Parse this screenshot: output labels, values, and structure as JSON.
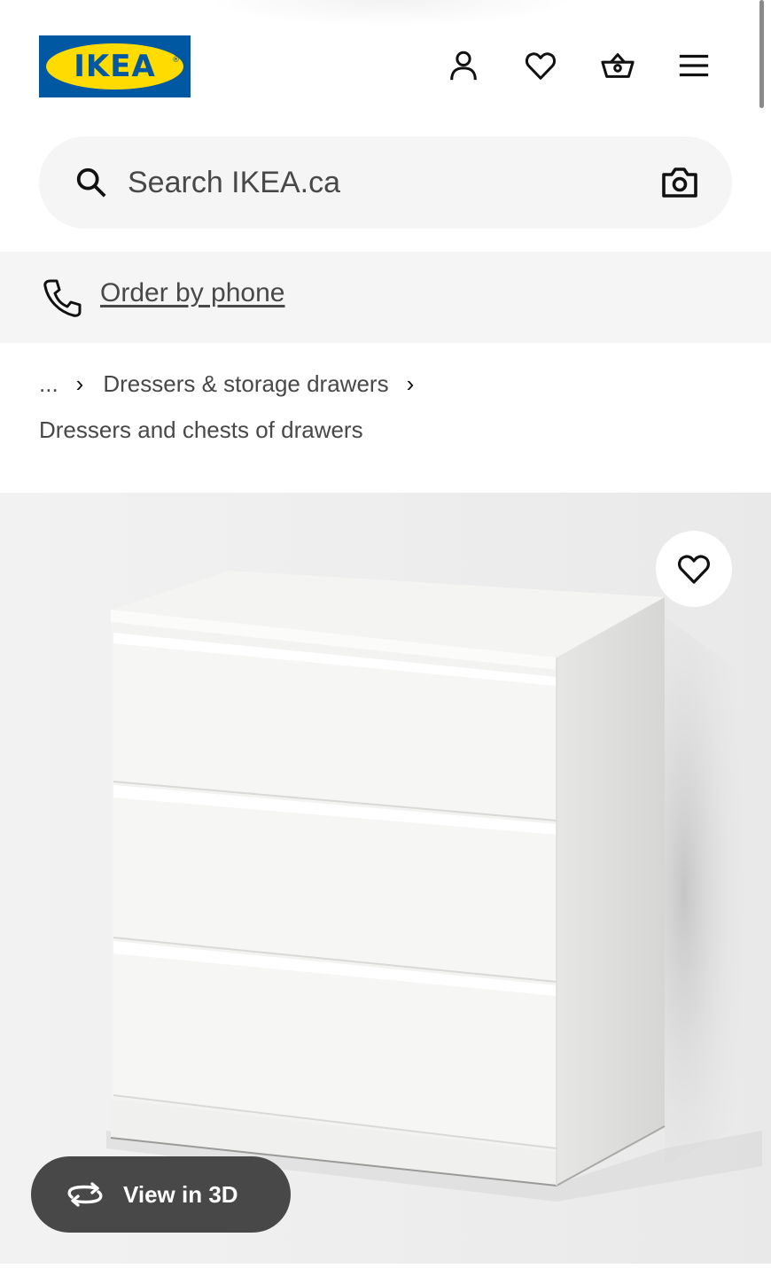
{
  "brand": {
    "logo_text": "IKEA",
    "colors": {
      "blue": "#0058a3",
      "yellow": "#ffdb00",
      "dark_grey": "#484848",
      "light_grey": "#f5f5f5"
    }
  },
  "header": {
    "icons": [
      "person-icon",
      "heart-icon",
      "shopping-bag-icon",
      "hamburger-menu-icon"
    ]
  },
  "search": {
    "placeholder": "Search IKEA.ca",
    "search_icon": "search-icon",
    "camera_icon": "camera-icon"
  },
  "order_by_phone": {
    "label": "Order by phone",
    "icon": "phone-icon"
  },
  "breadcrumb": {
    "ellipsis": "...",
    "items": [
      "Dressers & storage drawers",
      "Dressers and chests of drawers"
    ]
  },
  "product_image": {
    "subject": "white 3-drawer dresser",
    "favourite_icon": "heart-icon",
    "view_3d_label": "View in 3D",
    "view_3d_icon": "rotate-3d-icon"
  }
}
